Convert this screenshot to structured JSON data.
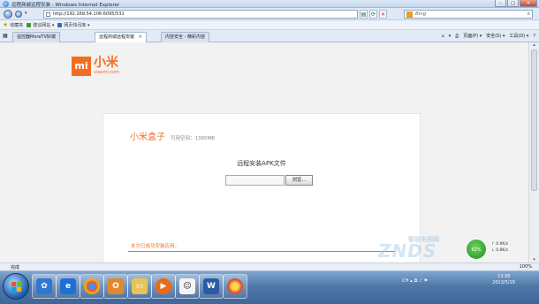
{
  "window": {
    "title": "远程商城远程安装 - Windows Internet Explorer",
    "min": "–",
    "max": "□",
    "close": "✕"
  },
  "address": {
    "url": "http://192.168.54.106:6095/531",
    "search_placeholder": "Bing",
    "refresh": "⟳",
    "stop": "✕"
  },
  "favorites": {
    "label": "收藏夹",
    "items": [
      "建议网站 ▾",
      "网页快讯库 ▾"
    ]
  },
  "tabs": [
    {
      "label": "遥控器MoreTV好端"
    },
    {
      "label": "远程商城远程安装"
    },
    {
      "label": "内容安全 - 精彩内容"
    }
  ],
  "command_bar": [
    "▾",
    "页面(P) ▾",
    "安全(S) ▾",
    "工具(O) ▾",
    "?"
  ],
  "logo": {
    "mark": "mi",
    "cn": "小米",
    "en": "xiaomi.com"
  },
  "card": {
    "product": "小米盒子",
    "space": "可用空间：1380MB",
    "form_title": "远程安装APK文件",
    "browse": "浏览...",
    "success": "本次已成功安装应用。"
  },
  "watermark": {
    "line1": "智能电视网",
    "line2": "ZNDS"
  },
  "gadget": {
    "pct": "62%",
    "up": "0.6K/s",
    "down": "0.8K/s"
  },
  "status": {
    "text": "完成",
    "zoom": "100%"
  },
  "clock": {
    "time": "13:39",
    "date": "2013/5/19"
  },
  "colors": {
    "accent": "#f16e21"
  }
}
